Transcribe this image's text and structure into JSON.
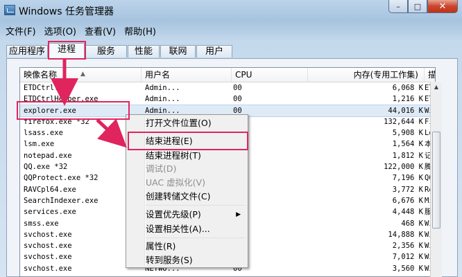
{
  "window": {
    "title": "Windows 任务管理器",
    "min": "–",
    "max": "□",
    "close": "✕"
  },
  "menu": [
    "文件(F)",
    "选项(O)",
    "查看(V)",
    "帮助(H)"
  ],
  "tabs": [
    "应用程序",
    "进程",
    "服务",
    "性能",
    "联网",
    "用户"
  ],
  "active_tab": "进程",
  "columns": {
    "name": "映像名称",
    "user": "用户名",
    "cpu": "CPU",
    "mem": "内存(专用工作集)",
    "desc": "描"
  },
  "processes": [
    {
      "name": "ETDCtrl.exe",
      "user": "Admin...",
      "cpu": "00",
      "mem": "6,068 K",
      "desc": "ET"
    },
    {
      "name": "ETDCtrlHelper.exe",
      "user": "Admin...",
      "cpu": "00",
      "mem": "1,216 K",
      "desc": "ET"
    },
    {
      "name": "explorer.exe",
      "user": "Admin...",
      "cpu": "00",
      "mem": "44,016 K",
      "desc": "Wi"
    },
    {
      "name": "firefox.exe *32",
      "user": "",
      "cpu": "",
      "mem": "132,644 K",
      "desc": "Fi"
    },
    {
      "name": "lsass.exe",
      "user": "",
      "cpu": "",
      "mem": "5,908 K",
      "desc": "Lo"
    },
    {
      "name": "lsm.exe",
      "user": "",
      "cpu": "",
      "mem": "1,564 K",
      "desc": "本"
    },
    {
      "name": "notepad.exe",
      "user": "",
      "cpu": "",
      "mem": "1,812 K",
      "desc": "记"
    },
    {
      "name": "QQ.exe *32",
      "user": "",
      "cpu": "",
      "mem": "122,000 K",
      "desc": "腾"
    },
    {
      "name": "QQProtect.exe *32",
      "user": "",
      "cpu": "",
      "mem": "7,196 K",
      "desc": "QQ"
    },
    {
      "name": "RAVCpl64.exe",
      "user": "",
      "cpu": "",
      "mem": "3,772 K",
      "desc": "Re"
    },
    {
      "name": "SearchIndexer.exe",
      "user": "",
      "cpu": "",
      "mem": "6,676 K",
      "desc": "Mi"
    },
    {
      "name": "services.exe",
      "user": "",
      "cpu": "",
      "mem": "4,448 K",
      "desc": "服"
    },
    {
      "name": "smss.exe",
      "user": "",
      "cpu": "",
      "mem": "468 K",
      "desc": "Wi"
    },
    {
      "name": "svchost.exe",
      "user": "",
      "cpu": "",
      "mem": "14,888 K",
      "desc": "Wi"
    },
    {
      "name": "svchost.exe",
      "user": "",
      "cpu": "",
      "mem": "2,356 K",
      "desc": "Wi"
    },
    {
      "name": "svchost.exe",
      "user": "",
      "cpu": "",
      "mem": "7,012 K",
      "desc": "Wi"
    },
    {
      "name": "svchost.exe",
      "user": "NETWO...",
      "cpu": "00",
      "mem": "3,560 K",
      "desc": "Wi"
    }
  ],
  "context_menu": [
    {
      "label": "打开文件位置(O)",
      "disabled": false
    },
    {
      "label": "结束进程(E)",
      "disabled": false
    },
    {
      "label": "结束进程树(T)",
      "disabled": false
    },
    {
      "label": "调试(D)",
      "disabled": true
    },
    {
      "label": "UAC 虚拟化(V)",
      "disabled": true
    },
    {
      "label": "创建转储文件(C)",
      "disabled": false
    },
    {
      "label": "设置优先级(P)",
      "disabled": false
    },
    {
      "label": "设置相关性(A)...",
      "disabled": false
    },
    {
      "label": "属性(R)",
      "disabled": false
    },
    {
      "label": "转到服务(S)",
      "disabled": false
    }
  ],
  "colors": {
    "highlight": "#e0245e",
    "selected_row": "#dfeaf7"
  }
}
